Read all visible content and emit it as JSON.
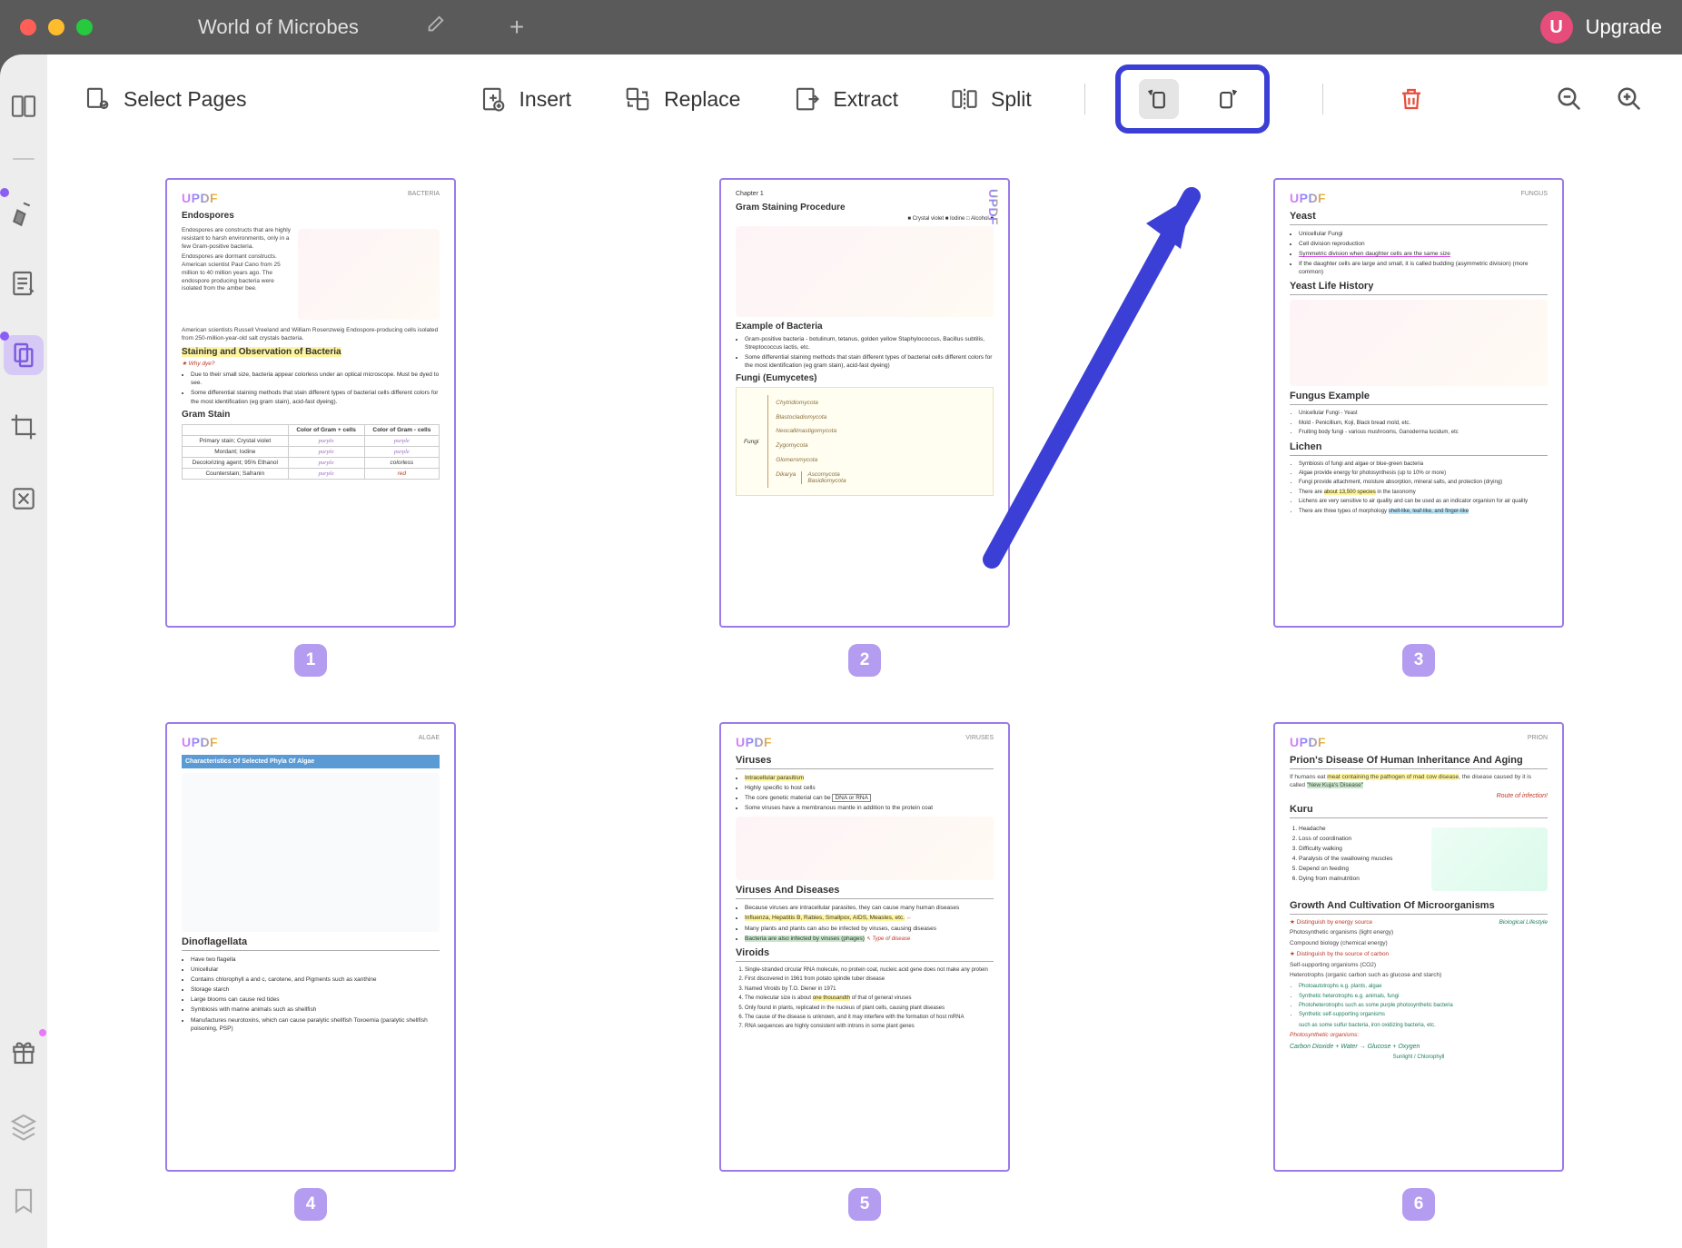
{
  "titlebar": {
    "tab_title": "World of Microbes",
    "upgrade_label": "Upgrade",
    "upgrade_badge": "U"
  },
  "toolbar": {
    "select_pages": "Select Pages",
    "insert": "Insert",
    "replace": "Replace",
    "extract": "Extract",
    "split": "Split"
  },
  "pages": {
    "1": {
      "num": "1",
      "category": "BACTERIA",
      "h1": "Endospores",
      "p1": "Endospores are constructs that are highly resistant to harsh environments, only in a few Gram-positive bacteria.",
      "p2": "Endospores are dormant constructs. American scientist Paul Cano from 25 million to 40 million years ago. The endospore producing bacteria were isolated from the amber bee.",
      "p3": "American scientists Russell Vreeland and William Rosenzweig Endospore-producing cells isolated from 250-million-year-old salt crystals bacteria.",
      "h2a": "Staining and Observation of Bacteria",
      "why": "Why dye?",
      "li1": "Due to their small size, bacteria appear colorless under an optical microscope. Must be dyed to see.",
      "li2": "Some differential staining methods that stain different types of bacterial cells different colors for the most identification (eg gram stain), acid-fast dyeing).",
      "h2b": "Gram Stain",
      "th1": "Color of Gram + cells",
      "th2": "Color of Gram - cells",
      "r1": "Primary stain; Crystal violet",
      "r2": "Mordant; Iodine",
      "r3": "Decolorizing agent; 95% Ethanol",
      "r4": "Counterstain; Safranin",
      "c_pur": "purple",
      "c_col": "colorless",
      "c_red": "red"
    },
    "2": {
      "num": "2",
      "chapter": "Chapter 1",
      "h1": "Gram Staining Procedure",
      "leg1": "Crystal violet",
      "leg2": "Iodine",
      "leg3": "Alcohol",
      "h2a": "Example of Bacteria",
      "li1": "Gram-positive bacteria - botulinum, tetanus, golden yellow Staphylococcus, Bacillus subtilis, Streptococcus lactis, etc.",
      "li2": "Some differential staining methods that stain different types of bacterial cells different colors for the most identification (eg gram stain), acid-fast dyeing)",
      "h2b": "Fungi (Eumycetes)",
      "fungi": "Fungi",
      "n1": "Chytridiomycota",
      "n2": "Blastocladiomycota",
      "n3": "Neocallimastigomycota",
      "n4": "Zygomycota",
      "n5": "Glomeromycota",
      "n6": "Dikarya",
      "n7": "Ascomycota",
      "n8": "Basidiomycota"
    },
    "3": {
      "num": "3",
      "category": "FUNGUS",
      "h1": "Yeast",
      "li1": "Unicellular Fungi",
      "li2": "Cell division reproduction",
      "li3": "Symmetric division when daughter cells are the same size",
      "li4": "If the daughter cells are large and small, it is called budding (asymmetric division) (more common)",
      "h2a": "Yeast Life History",
      "h2b": "Fungus Example",
      "fe1": "Unicellular Fungi - Yeast",
      "fe2": "Mold - Penicillium, Koji, Black bread mold, etc.",
      "fe3": "Fruiting body fungi - various mushrooms, Ganoderma lucidum, etc",
      "h2c": "Lichen",
      "lc1": "Symbiosis of fungi and algae or blue-green bacteria",
      "lc2": "Algae provide energy for photosynthesis (up to 10% or more)",
      "lc3": "Fungi provide attachment, moisture absorption, mineral salts, and protection (drying)",
      "lc4_a": "There are",
      "lc4_b": "about 13,500 species",
      "lc4_c": "in the taxonomy",
      "lc5": "Lichens are very sensitive to air quality and can be used as an indicator organism for air quality",
      "lc6_a": "There are three types of morphology",
      "lc6_b": "shell-like, leaf-like, and finger-like"
    },
    "4": {
      "num": "4",
      "category": "ALGAE",
      "h1": "Characteristics Of Selected Phyla Of Algae",
      "h2": "Dinoflagellata",
      "d1": "Have two flagella",
      "d2": "Unicellular",
      "d3": "Contains chlorophyll a and c, carotene, and Pigments such as xanthine",
      "d4": "Storage starch",
      "d5": "Large blooms can cause red tides",
      "d6": "Symbiosis with marine animals such as shellfish",
      "d7": "Manufactures neurotoxins, which can cause paralytic shellfish Toxoemia (paralytic shellfish poisoning, PSP)"
    },
    "5": {
      "num": "5",
      "category": "VIRUSES",
      "h1": "Viruses",
      "v1": "Intracellular parasitism",
      "v2": "Highly specific to host cells",
      "v3_a": "The core genetic material can be",
      "v3_b": "DNA or RNA",
      "v4": "Some viruses have a membranous mantle in addition to the protein coat",
      "h2a": "Viruses And Diseases",
      "vd1": "Because viruses are intracellular parasites, they can cause many human diseases",
      "vd2": "Influenza, Hepatitis B, Rabies, Smallpox, AIDS, Measles, etc.",
      "vd3": "Many plants and plants can also be infected by viruses, causing diseases",
      "vd4": "Bacteria are also infected by viruses (phages)",
      "anno": "Type of disease",
      "h2b": "Viroids",
      "vr1": "Single-stranded circular RNA molecule, no protein coat, nucleic acid gene does not make any protein",
      "vr2": "First discovered in 1961 from potato spindle tuber disease",
      "vr3": "Named Viroids by T.O. Diener in 1971",
      "vr4_a": "The molecular size is about",
      "vr4_b": "one thousandth",
      "vr4_c": "of that of general viruses",
      "vr5": "Only found in plants, replicated in the nucleus of plant cells, causing plant diseases",
      "vr6": "The cause of the disease is unknown, and it may interfere with the formation of host mRNA",
      "vr7": "RNA sequences are highly consistent with introns in some plant genes"
    },
    "6": {
      "num": "6",
      "category": "PRION",
      "h1": "Prion's Disease Of Human Inheritance And Aging",
      "p1_a": "If humans eat",
      "p1_b": "meat containing the pathogen of mad cow disease",
      "p1_c": "the disease caused by it is called",
      "p1_d": "\"New Kuja's Disease\"",
      "anno1": "Route of infection!",
      "h2a": "Kuru",
      "k1": "Headache",
      "k2": "Loss of coordination",
      "k3": "Difficulty walking",
      "k4": "Paralysis of the swallowing muscles",
      "k5": "Depend on feeding",
      "k6": "Dying from malnutrition",
      "h2b": "Growth And Cultivation Of Microorganisms",
      "g1a": "Distinguish by energy source",
      "g1a_anno": "Biological Lifestyle",
      "g1b": "Photosynthetic organisms (light energy)",
      "g1c": "Compound biology (chemical energy)",
      "g2a": "Distinguish by the source of carbon",
      "g2b": "Self-supporting organisms (CO2)",
      "g2c": "Heterotrophs (organic carbon such as glucose and starch)",
      "pa": "Photoautotrophs e.g. plants, algae",
      "pb": "Synthetic heterotrophs e.g. animals, fungi",
      "pc": "Photoheterotrophs such as some purple photosynthetic bacteria",
      "pd": "Synthetic self-supporting organisms",
      "pe": "such as some sulfur bacteria, iron oxidizing bacteria, etc.",
      "eq_label": "Photosynthetic organisms:",
      "eq": "Carbon Dioxide + Water → Glucose + Oxygen",
      "eq_sun": "Sunlight",
      "eq_ch": "Chlorophyll"
    }
  }
}
